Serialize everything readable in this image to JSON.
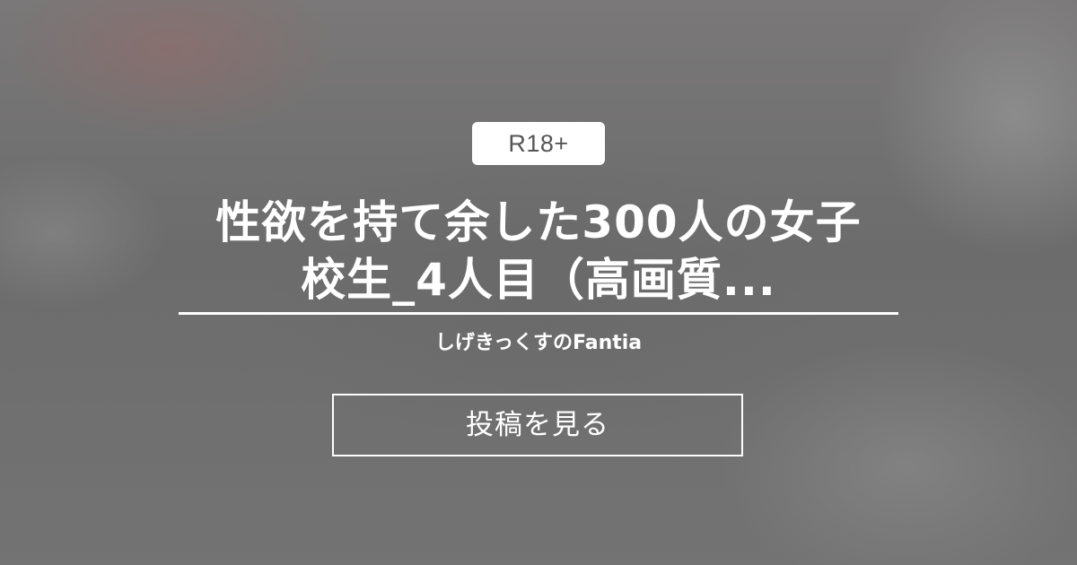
{
  "badge": {
    "label": "R18+"
  },
  "post": {
    "title_line1": "性欲を持て余した300人の女子",
    "title_line2": "校生_4人目（高画質..."
  },
  "creator": {
    "name": "しげきっくすのFantia"
  },
  "actions": {
    "view_post_label": "投稿を見る"
  },
  "colors": {
    "text": "#ffffff",
    "badge_bg": "#ffffff",
    "badge_text": "#555555",
    "background": "#6b6b6b"
  }
}
